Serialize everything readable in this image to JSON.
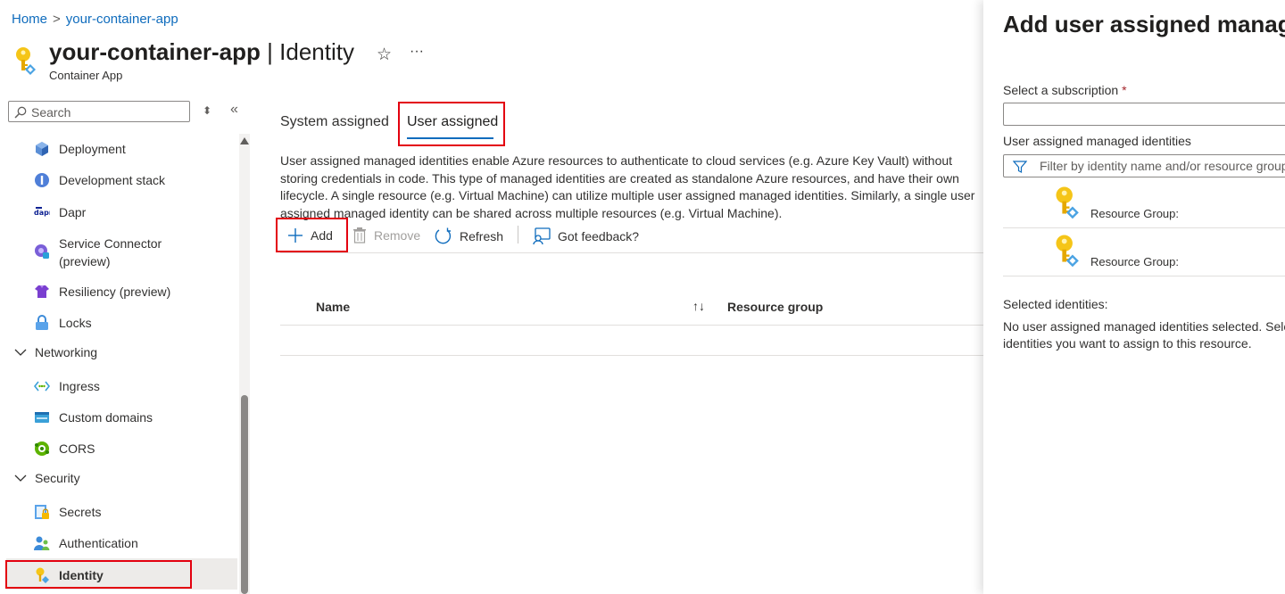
{
  "breadcrumb": {
    "home": "Home",
    "separator": ">",
    "current": "your-container-app"
  },
  "header": {
    "resource_name": "your-container-app",
    "page_name": "| Identity",
    "subtitle": "Container App",
    "favorite_icon": "☆",
    "more_icon": "···"
  },
  "sidebar": {
    "search_placeholder": "Search",
    "sort_icon": "⬍",
    "collapse_icon": "«",
    "items": [
      {
        "label": "Deployment",
        "icon": "cube-icon"
      },
      {
        "label": "Development stack",
        "icon": "info-circle-icon"
      },
      {
        "label": "Dapr",
        "icon": "dapr-icon"
      },
      {
        "label": "Service Connector",
        "label2": "(preview)",
        "icon": "service-connector-icon"
      },
      {
        "label": "Resiliency (preview)",
        "icon": "shirt-icon"
      },
      {
        "label": "Locks",
        "icon": "lock-icon"
      }
    ],
    "networking": {
      "label": "Networking",
      "items": [
        {
          "label": "Ingress",
          "icon": "ingress-icon"
        },
        {
          "label": "Custom domains",
          "icon": "domain-icon"
        },
        {
          "label": "CORS",
          "icon": "cors-icon"
        }
      ]
    },
    "security": {
      "label": "Security",
      "items": [
        {
          "label": "Secrets",
          "icon": "secrets-icon"
        },
        {
          "label": "Authentication",
          "icon": "people-icon"
        },
        {
          "label": "Identity",
          "icon": "key-icon"
        }
      ]
    }
  },
  "tabs": {
    "system": "System assigned",
    "user": "User assigned"
  },
  "description": "User assigned managed identities enable Azure resources to authenticate to cloud services (e.g. Azure Key Vault) without storing credentials in code. This type of managed identities are created as standalone Azure resources, and have their own lifecycle. A single resource (e.g. Virtual Machine) can utilize multiple user assigned managed identities. Similarly, a single user assigned managed identity can be shared across multiple resources (e.g. Virtual Machine).",
  "toolbar": {
    "add": "Add",
    "remove": "Remove",
    "refresh": "Refresh",
    "feedback": "Got feedback?"
  },
  "table": {
    "col_name": "Name",
    "sort_icon": "↑↓",
    "col_rg": "Resource group"
  },
  "panel": {
    "title": "Add user assigned managed identity",
    "subscription_label": "Select a subscription",
    "required_mark": "*",
    "subscription_value": "",
    "identities_label": "User assigned managed identities",
    "filter_placeholder": "Filter by identity name and/or resource group",
    "identities": [
      {
        "rg_label": "Resource Group:"
      },
      {
        "rg_label": "Resource Group:"
      }
    ],
    "selected_label": "Selected identities:",
    "none_selected": "No user assigned managed identities selected. Select",
    "none_selected2": "identities you want to assign to this resource."
  },
  "colors": {
    "accent": "#0f6cbd",
    "highlight_box": "#e3000f",
    "selected_bg": "#edebe9"
  }
}
